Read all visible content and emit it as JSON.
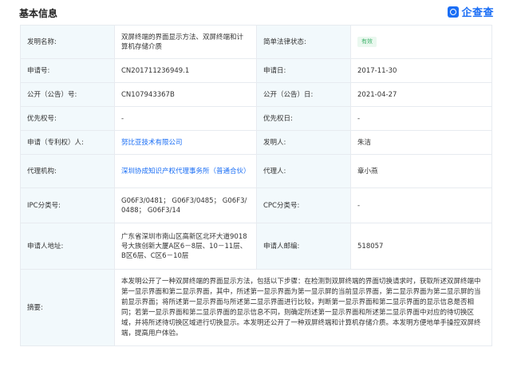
{
  "header": {
    "title": "基本信息",
    "brand": "企查查",
    "brand_icon": "qichacha-logo-icon"
  },
  "rows": {
    "name_label": "发明名称:",
    "name_value": "双屏终端的界面显示方法、双屏终端和计算机存储介质",
    "status_label": "简单法律状态:",
    "status_value": "有效",
    "app_no_label": "申请号:",
    "app_no_value": "CN201711236949.1",
    "app_date_label": "申请日:",
    "app_date_value": "2017-11-30",
    "pub_no_label": "公开（公告）号:",
    "pub_no_value": "CN107943367B",
    "pub_date_label": "公开（公告）日:",
    "pub_date_value": "2021-04-27",
    "priority_no_label": "优先权号:",
    "priority_no_value": "-",
    "priority_date_label": "优先权日:",
    "priority_date_value": "-",
    "applicant_label": "申请（专利权）人:",
    "applicant_value": "努比亚技术有限公司",
    "inventor_label": "发明人:",
    "inventor_value": "朱洁",
    "agency_label": "代理机构:",
    "agency_value": "深圳协成知识产权代理事务所（普通合伙）",
    "agent_label": "代理人:",
    "agent_value": "章小燕",
    "ipc_label": "IPC分类号:",
    "ipc_value": "G06F3/0481； G06F3/0485； G06F3/0488； G06F3/14",
    "cpc_label": "CPC分类号:",
    "cpc_value": "-",
    "address_label": "申请人地址:",
    "address_value": "广东省深圳市南山区高新区北环大道9018号大族创新大厦A区6－8层、10－11层、B区6层、C区6－10层",
    "postcode_label": "申请人邮编:",
    "postcode_value": "518057",
    "abstract_label": "摘要:",
    "abstract_value": "本发明公开了一种双屏终端的界面显示方法，包括以下步骤：在检测到双屏终端的界面切换请求时，获取所述双屏终端中第一显示界面和第二显示界面，其中，所述第一显示界面为第一显示屏的当前显示界面，第二显示界面为第二显示屏的当前显示界面；将所述第一显示界面与所述第二显示界面进行比较，判断第一显示界面和第二显示界面的显示信息是否相同；若第一显示界面和第二显示界面的显示信息不同，则确定所述第一显示界面和所述第二显示界面中对应的待切换区域，并将所述待切换区域进行切换显示。本发明还公开了一种双屏终端和计算机存储介质。本发明方便地单手操控双屏终端，提高用户体验。"
  },
  "colors": {
    "label_bg": "#f2f9fc",
    "border": "#e7ebf0",
    "link": "#1a6ef5",
    "status_bg": "#eaf8ef",
    "status_text": "#3fb26b",
    "brand": "#1a6ef5"
  }
}
